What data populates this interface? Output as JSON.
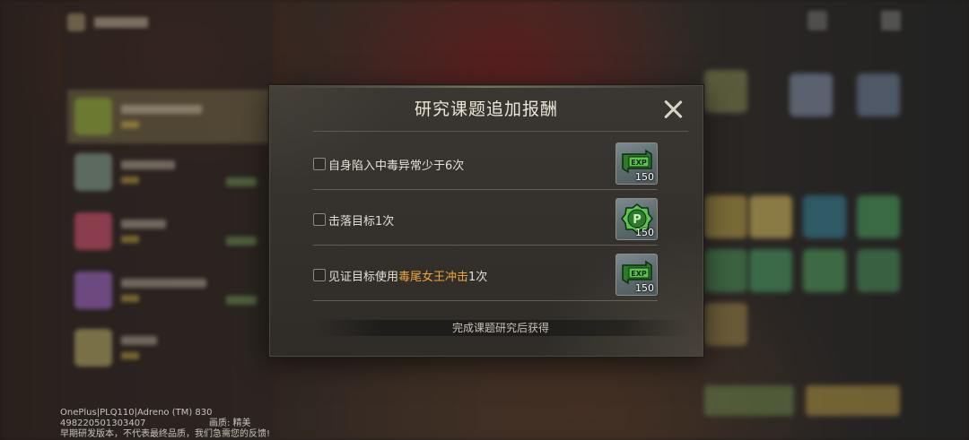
{
  "dialog": {
    "title": "研究课题追加报酬",
    "footer_note": "完成课题研究后获得",
    "tasks": [
      {
        "text_before": "自身陷入中毒异常少于6次",
        "highlight": "",
        "text_after": "",
        "checked": false,
        "reward": {
          "icon": "exp-ticket-icon",
          "quantity": "150"
        }
      },
      {
        "text_before": "击落目标1次",
        "highlight": "",
        "text_after": "",
        "checked": false,
        "reward": {
          "icon": "point-badge-icon",
          "quantity": "150"
        }
      },
      {
        "text_before": "见证目标使用",
        "highlight": "毒尾女王冲击",
        "text_after": "1次",
        "checked": false,
        "reward": {
          "icon": "exp-ticket-icon",
          "quantity": "150"
        }
      }
    ]
  },
  "footer": {
    "device": "OnePlus|PLQ110|Adreno (TM) 830",
    "build_id": "498220501303407",
    "quality": "画质: 精美",
    "disclaimer": "早期研发版本，不代表最终品质，我们急需您的反馈!"
  },
  "colors": {
    "highlight": "#f0a63c",
    "reward_icon_green": "#4fb84a"
  }
}
